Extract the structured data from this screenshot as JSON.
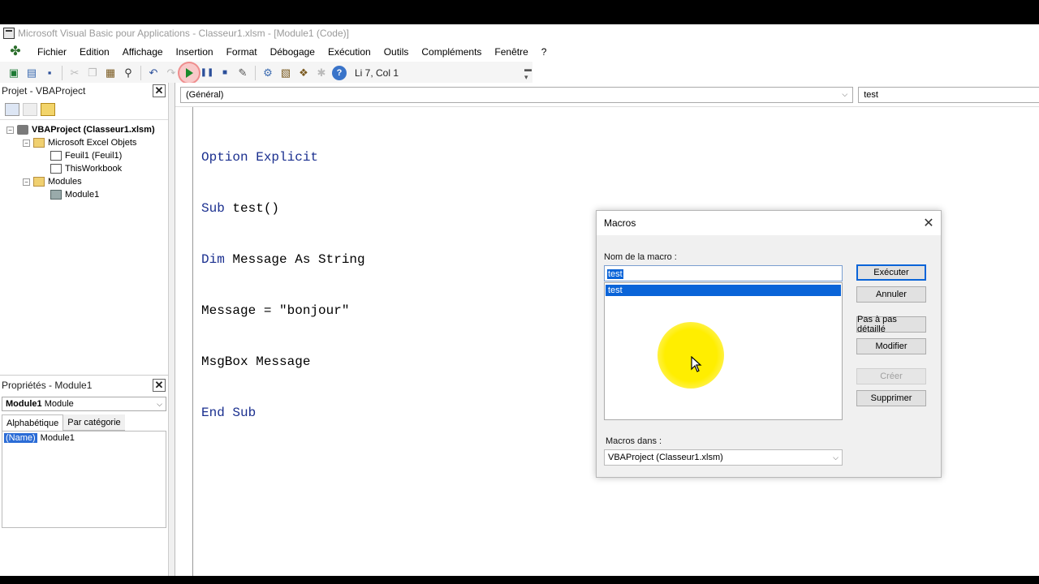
{
  "window": {
    "title": "Microsoft Visual Basic pour Applications - Classeur1.xlsm - [Module1 (Code)]"
  },
  "menu": [
    "Fichier",
    "Edition",
    "Affichage",
    "Insertion",
    "Format",
    "Débogage",
    "Exécution",
    "Outils",
    "Compléments",
    "Fenêtre",
    "?"
  ],
  "toolbar": {
    "position": "Li 7, Col 1"
  },
  "project_panel": {
    "title": "Projet - VBAProject",
    "tree": [
      {
        "label": "VBAProject (Classeur1.xlsm)",
        "icon": "vbaproject-icon"
      },
      {
        "label": "Microsoft Excel Objets",
        "icon": "folder-icon"
      },
      {
        "label": "Feuil1 (Feuil1)",
        "icon": "sheet-icon"
      },
      {
        "label": "ThisWorkbook",
        "icon": "workbook-icon"
      },
      {
        "label": "Modules",
        "icon": "folder-icon"
      },
      {
        "label": "Module1",
        "icon": "module-icon"
      }
    ]
  },
  "properties_panel": {
    "title": "Propriétés - Module1",
    "object_name": "Module1",
    "object_type": "Module",
    "tabs": [
      "Alphabétique",
      "Par catégorie"
    ],
    "rows": [
      {
        "key": "(Name)",
        "value": "Module1"
      }
    ]
  },
  "code_window": {
    "object_combo": "(Général)",
    "proc_combo": "test",
    "lines": [
      {
        "kw": "Option Explicit",
        "rest": ""
      },
      {
        "kw": "Sub ",
        "rest": "test()"
      },
      {
        "kw": "Dim ",
        "rest": "Message As String"
      },
      {
        "kw": "",
        "rest": "Message = \"bonjour\""
      },
      {
        "kw": "",
        "rest": "MsgBox Message"
      },
      {
        "kw": "End Sub",
        "rest": ""
      }
    ]
  },
  "macro_dialog": {
    "title": "Macros",
    "name_label": "Nom de la macro :",
    "name_value": "test",
    "list": [
      "test"
    ],
    "buttons": {
      "run": "Exécuter",
      "cancel": "Annuler",
      "step": "Pas à pas détaillé",
      "edit": "Modifier",
      "create": "Créer",
      "delete": "Supprimer"
    },
    "macros_in_label": "Macros dans :",
    "macros_in_value": "VBAProject (Classeur1.xlsm)"
  },
  "colors": {
    "keyword": "#1a2f8f",
    "selection": "#0a64d8",
    "highlight": "#ffee00"
  }
}
